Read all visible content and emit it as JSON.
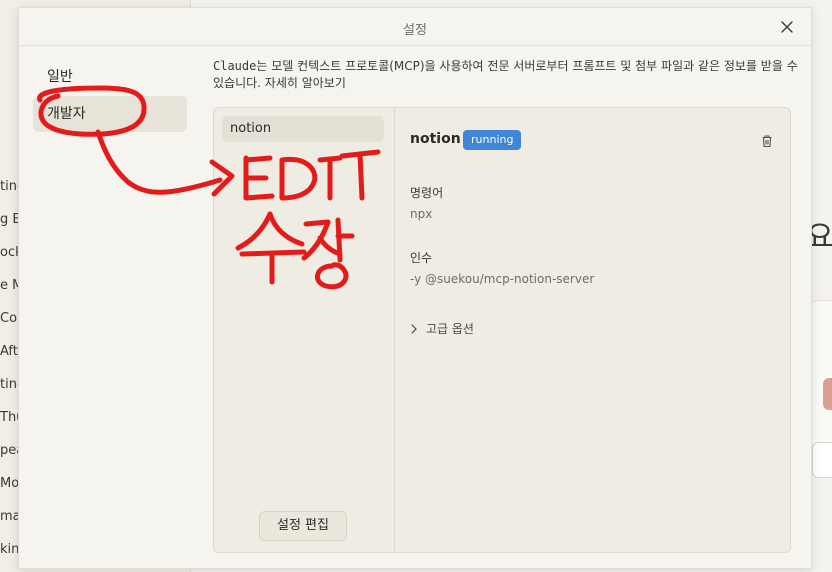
{
  "background": {
    "left_items": [
      "ting",
      "g Ep",
      "ock",
      "e M",
      "Con",
      "Aft",
      "ting",
      "Thu",
      "pea",
      "Mo",
      "ma",
      "kin"
    ],
    "right_glyph": "요"
  },
  "dialog": {
    "title": "설정",
    "close_icon": "close-icon",
    "nav": [
      {
        "label": "일반",
        "active": false
      },
      {
        "label": "개발자",
        "active": true
      }
    ],
    "description": {
      "brand": "Claude",
      "text": "는 모델 컨텍스트 프로토콜(MCP)을 사용하여 전문 서버로부터 프롬프트 및 첨부 파일과 같은 정보를 받을 수 있습니다. ",
      "link": "자세히 알아보기"
    },
    "servers": [
      {
        "name": "notion"
      }
    ],
    "edit_button": "설정 편집",
    "detail": {
      "name": "notion",
      "status": "running",
      "status_color": "#3f86d9",
      "command_label": "명령어",
      "command_value": "npx",
      "args_label": "인수",
      "args_value": "-y @suekou/mcp-notion-server",
      "advanced_label": "고급 옵션",
      "trash_icon": "trash-icon"
    }
  },
  "annotation": {
    "color": "#e31b1b",
    "text_en": "EDIT",
    "text_ko": "수정"
  }
}
